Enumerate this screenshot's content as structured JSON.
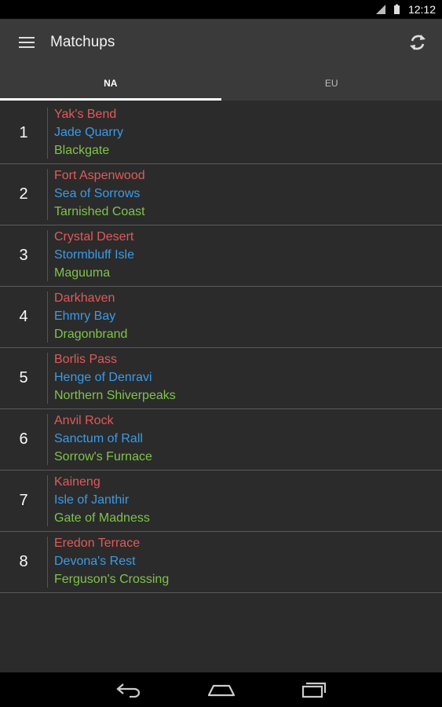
{
  "status": {
    "time": "12:12"
  },
  "header": {
    "title": "Matchups"
  },
  "tabs": [
    {
      "label": "NA"
    },
    {
      "label": "EU"
    }
  ],
  "matchups": [
    {
      "rank": "1",
      "red": "Yak's Bend",
      "blue": "Jade Quarry",
      "green": "Blackgate"
    },
    {
      "rank": "2",
      "red": "Fort Aspenwood",
      "blue": "Sea of Sorrows",
      "green": "Tarnished Coast"
    },
    {
      "rank": "3",
      "red": "Crystal Desert",
      "blue": "Stormbluff Isle",
      "green": "Maguuma"
    },
    {
      "rank": "4",
      "red": "Darkhaven",
      "blue": "Ehmry Bay",
      "green": "Dragonbrand"
    },
    {
      "rank": "5",
      "red": "Borlis Pass",
      "blue": "Henge of Denravi",
      "green": "Northern Shiverpeaks"
    },
    {
      "rank": "6",
      "red": "Anvil Rock",
      "blue": "Sanctum of Rall",
      "green": "Sorrow's Furnace"
    },
    {
      "rank": "7",
      "red": "Kaineng",
      "blue": "Isle of Janthir",
      "green": "Gate of Madness"
    },
    {
      "rank": "8",
      "red": "Eredon Terrace",
      "blue": "Devona's Rest",
      "green": "Ferguson's Crossing"
    }
  ],
  "colors": {
    "red": "#e05a5a",
    "blue": "#3b9be8",
    "green": "#7fc44a",
    "background": "#2b2b2b",
    "bar": "#3a3a3a"
  },
  "icons": {
    "menu": "menu-icon",
    "refresh": "refresh-icon",
    "back": "back-icon",
    "home": "home-icon",
    "recents": "recents-icon"
  }
}
